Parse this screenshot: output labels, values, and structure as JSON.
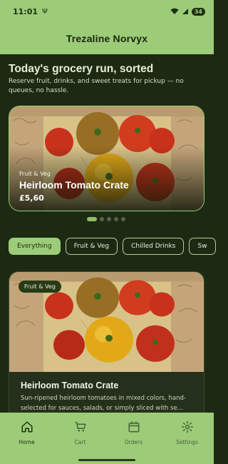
{
  "status": {
    "time": "11:01",
    "usb_glyph": "Ψ",
    "battery": "34"
  },
  "app": {
    "title": "Trezaline Norvyx"
  },
  "hero": {
    "heading": "Today's grocery run, sorted",
    "subheading": "Reserve fruit, drinks, and sweet treats for pickup — no queues, no hassle."
  },
  "carousel": {
    "tag": "Fruit & Veg",
    "title": "Heirloom Tomato Crate",
    "price": "£5,60",
    "pages": 5,
    "active_page": 1
  },
  "chips": [
    {
      "label": "Everything",
      "active": true
    },
    {
      "label": "Fruit & Veg",
      "active": false
    },
    {
      "label": "Chilled Drinks",
      "active": false
    },
    {
      "label": "Sw",
      "active": false
    }
  ],
  "product": {
    "badge": "Fruit & Veg",
    "title": "Heirloom Tomato Crate",
    "description": "Sun-ripened heirloom tomatoes in mixed colors, hand-selected for sauces, salads, or simply sliced with se..."
  },
  "nav": [
    {
      "label": "Home",
      "icon": "home-icon",
      "active": true
    },
    {
      "label": "Cart",
      "icon": "cart-icon",
      "active": false
    },
    {
      "label": "Orders",
      "icon": "calendar-icon",
      "active": false
    },
    {
      "label": "Settings",
      "icon": "gear-icon",
      "active": false
    }
  ],
  "colors": {
    "accent": "#9ccc78",
    "background": "#1d2a13",
    "card": "#24301b"
  }
}
